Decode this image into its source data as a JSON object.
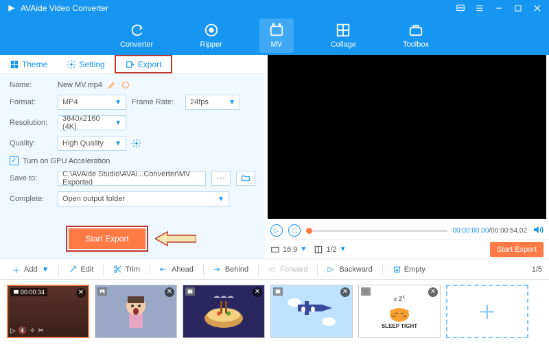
{
  "app": {
    "title": "AVAide Video Converter"
  },
  "nav": {
    "converter": "Converter",
    "ripper": "Ripper",
    "mv": "MV",
    "collage": "Collage",
    "toolbox": "Toolbox"
  },
  "tabs": {
    "theme": "Theme",
    "setting": "Setting",
    "export": "Export"
  },
  "form": {
    "name_label": "Name:",
    "name_value": "New MV.mp4",
    "format_label": "Format:",
    "format_value": "MP4",
    "framerate_label": "Frame Rate:",
    "framerate_value": "24fps",
    "resolution_label": "Resolution:",
    "resolution_value": "3840x2160 (4K)",
    "quality_label": "Quality:",
    "quality_value": "High Quality",
    "gpu_label": "Turn on GPU Acceleration",
    "saveto_label": "Save to:",
    "saveto_value": "C:\\AVAide Studio\\AVAi...Converter\\MV Exported",
    "complete_label": "Complete:",
    "complete_value": "Open output folder",
    "start_export": "Start Export"
  },
  "player": {
    "time_current": "00:00:00.00",
    "time_total": "00:00:54.02",
    "aspect": "16:9",
    "page": "1/2",
    "start_export": "Start Export"
  },
  "toolbar": {
    "add": "Add",
    "edit": "Edit",
    "trim": "Trim",
    "ahead": "Ahead",
    "behind": "Behind",
    "forward": "Forward",
    "backward": "Backward",
    "empty": "Empty",
    "page": "1/5"
  },
  "thumbs": {
    "duration1": "00:00:34",
    "sleep_tight": "SLEEP TIGHT"
  }
}
